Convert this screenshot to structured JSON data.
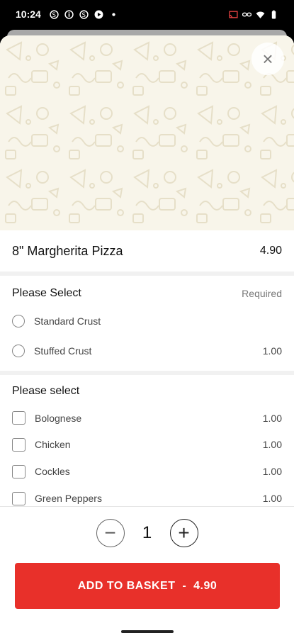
{
  "status_bar": {
    "time": "10:24",
    "left_icons": [
      "s-icon",
      "info-icon",
      "s-icon",
      "play-icon",
      "dot-icon"
    ],
    "right_icons": [
      "cast-icon",
      "link-icon",
      "wifi-icon",
      "battery-icon"
    ]
  },
  "item": {
    "title": "8\" Margherita Pizza",
    "price": "4.90"
  },
  "close_glyph": "×",
  "sections": [
    {
      "title": "Please Select",
      "required_label": "Required",
      "type": "radio",
      "options": [
        {
          "label": "Standard Crust",
          "price": ""
        },
        {
          "label": "Stuffed Crust",
          "price": "1.00"
        }
      ]
    },
    {
      "title": "Please select",
      "type": "checkbox",
      "options": [
        {
          "label": "Bolognese",
          "price": "1.00"
        },
        {
          "label": "Chicken",
          "price": "1.00"
        },
        {
          "label": "Cockles",
          "price": "1.00"
        },
        {
          "label": "Green Peppers",
          "price": "1.00"
        }
      ]
    }
  ],
  "quantity": {
    "value": "1",
    "minus_glyph": "−",
    "plus_glyph": "+"
  },
  "add_button": {
    "label": "ADD TO BASKET  -  4.90"
  },
  "colors": {
    "accent": "#e8302a",
    "hero_bg": "#f8f5ea"
  }
}
